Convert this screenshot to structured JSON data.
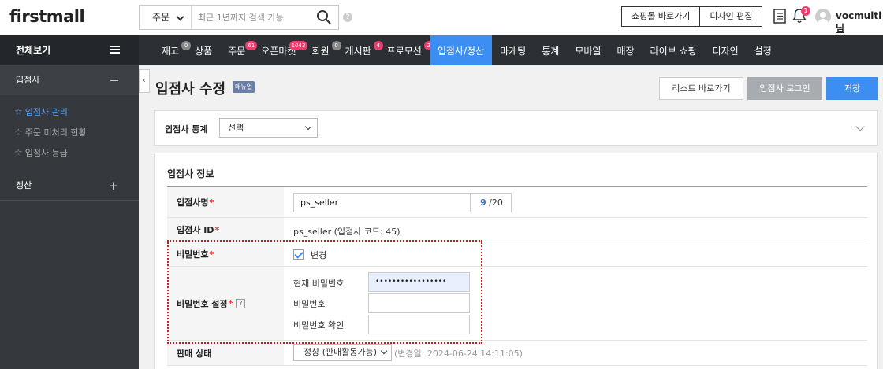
{
  "header": {
    "logo": "firstmall",
    "search": {
      "type": "주문",
      "placeholder": "최근 1년까지 검색 가능"
    },
    "help": "?",
    "buttons": [
      "쇼핑몰 바로가기",
      "디자인 편집"
    ],
    "notification_count": "1",
    "username": "vocmulti님"
  },
  "nav": {
    "all_label": "전체보기",
    "items": [
      {
        "label": "재고",
        "badge": "0",
        "badge_color": "gray"
      },
      {
        "label": "상품",
        "badge": ""
      },
      {
        "label": "주문",
        "badge": "61",
        "badge_color": "red"
      },
      {
        "label": "오픈마켓",
        "badge": "1043",
        "badge_color": "red"
      },
      {
        "label": "회원",
        "badge": "0",
        "badge_color": "gray"
      },
      {
        "label": "게시판",
        "badge": "4",
        "badge_color": "red"
      },
      {
        "label": "프로모션",
        "badge": "2",
        "badge_color": "red"
      },
      {
        "label": "입점사/정산",
        "badge": "",
        "active": true
      },
      {
        "label": "마케팅",
        "badge": ""
      },
      {
        "label": "통계",
        "badge": ""
      },
      {
        "label": "모바일",
        "badge": ""
      },
      {
        "label": "매장",
        "badge": ""
      },
      {
        "label": "라이브 쇼핑",
        "badge": ""
      },
      {
        "label": "디자인",
        "badge": ""
      },
      {
        "label": "설정",
        "badge": ""
      }
    ]
  },
  "sidebar": {
    "section1": "입점사",
    "items": [
      "입점사 관리",
      "주문 미처리 현황",
      "입점사 등급"
    ],
    "section2": "정산"
  },
  "page": {
    "title": "입점사 수정",
    "manual": "매뉴얼",
    "btn_list": "리스트 바로가기",
    "btn_login": "입점사 로그인",
    "btn_save": "저장"
  },
  "stats": {
    "label": "입점사 통계",
    "select": "선택"
  },
  "info": {
    "title": "입점사 정보",
    "name_label": "입점사명",
    "name_value": "ps_seller",
    "name_count": "9",
    "name_max": "/20",
    "id_label": "입점사 ID",
    "id_value": "ps_seller (입점사 코드: 45)",
    "pw_label": "비밀번호",
    "pw_change": "변경",
    "pw_set_label": "비밀번호 설정",
    "help": "?",
    "pw_current_label": "현재 비밀번호",
    "pw_current_value": "•••••••••••••••••",
    "pw_new_label": "비밀번호",
    "pw_confirm_label": "비밀번호 확인",
    "sale_label": "판매 상태",
    "sale_value": "정상 (판매활동가능)",
    "sale_date": "(변경일: 2024-06-24 14:11:05)"
  },
  "colors": {
    "accent": "#3d8ef3",
    "badge_red": "#e83f6f",
    "highlight": "#c41e24"
  }
}
